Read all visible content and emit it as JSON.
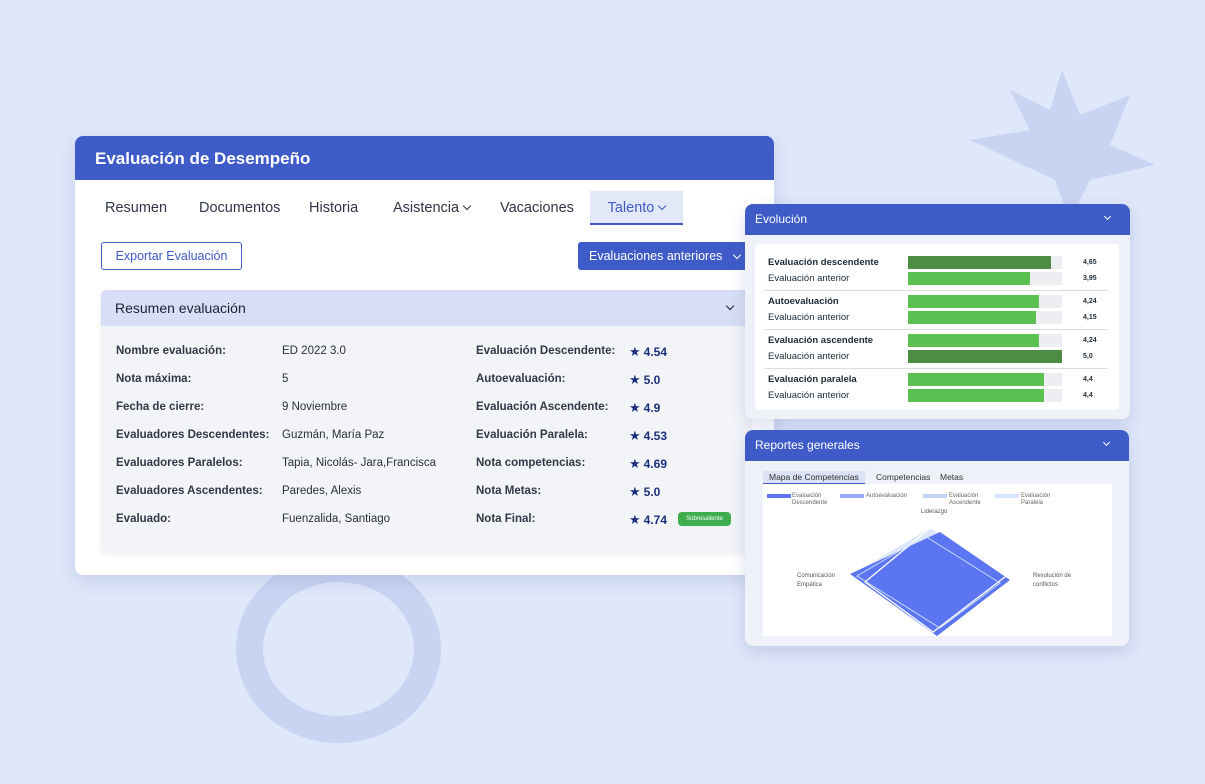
{
  "main": {
    "title": "Evaluación de Desempeño",
    "tabs": [
      {
        "label": "Resumen"
      },
      {
        "label": "Documentos"
      },
      {
        "label": "Historia"
      },
      {
        "label": "Asistencia"
      },
      {
        "label": "Vacaciones"
      },
      {
        "label": "Talento",
        "active": true
      }
    ],
    "export_label": "Exportar Evaluación",
    "previous_label": "Evaluaciones anteriores",
    "panel_title": "Resumen evaluación",
    "left_rows": [
      {
        "label": "Nombre evaluación:",
        "value": "ED 2022 3.0"
      },
      {
        "label": "Nota máxima:",
        "value": "5"
      },
      {
        "label": "Fecha de cierre:",
        "value": "9 Noviembre"
      },
      {
        "label": "Evaluadores Descendentes:",
        "value": "Guzmán, María Paz"
      },
      {
        "label": "Evaluadores Paralelos:",
        "value": "Tapia, Nicolás- Jara,Francisca"
      },
      {
        "label": "Evaluadores Ascendentes:",
        "value": "Paredes, Alexis"
      },
      {
        "label": "Evaluado:",
        "value": "Fuenzalida, Santiago"
      }
    ],
    "right_rows": [
      {
        "label": "Evaluación Descendente:",
        "score": "4.54"
      },
      {
        "label": "Autoevaluación:",
        "score": "5.0"
      },
      {
        "label": "Evaluación Ascendente:",
        "score": "4.9"
      },
      {
        "label": "Evaluación Paralela:",
        "score": "4.53"
      },
      {
        "label": "Nota competencias:",
        "score": "4.69"
      },
      {
        "label": "Nota Metas:",
        "score": "5.0"
      },
      {
        "label": "Nota Final:",
        "score": "4.74"
      }
    ],
    "final_badge": "Sobresaliente"
  },
  "evolucion": {
    "title": "Evolución",
    "rows": [
      {
        "label": "Evaluación descendente",
        "value_text": "4,65",
        "value": 4.65,
        "bold": true,
        "color": "#4e8c45"
      },
      {
        "label": "Evaluación anterior",
        "value_text": "3,95",
        "value": 3.95,
        "bold": false,
        "color": "#5cbf52"
      },
      {
        "label": "Autoevaluación",
        "value_text": "4,24",
        "value": 4.24,
        "bold": true,
        "color": "#5cbf52"
      },
      {
        "label": "Evaluación anterior",
        "value_text": "4,15",
        "value": 4.15,
        "bold": false,
        "color": "#5cbf52"
      },
      {
        "label": "Evaluación ascendente",
        "value_text": "4,24",
        "value": 4.24,
        "bold": true,
        "color": "#5cbf52"
      },
      {
        "label": "Evaluación anterior",
        "value_text": "5,0",
        "value": 5.0,
        "bold": false,
        "color": "#4e8c45"
      },
      {
        "label": "Evaluación paralela",
        "value_text": "4,4",
        "value": 4.4,
        "bold": true,
        "color": "#5cbf52"
      },
      {
        "label": "Evaluación anterior",
        "value_text": "4,4",
        "value": 4.4,
        "bold": false,
        "color": "#5cbf52"
      }
    ]
  },
  "reportes": {
    "title": "Reportes generales",
    "tabs": [
      {
        "label": "Mapa de Competencias",
        "active": true
      },
      {
        "label": "Competencias"
      },
      {
        "label": "Metas"
      }
    ],
    "legend": [
      {
        "label": "Evaluación Descendente",
        "color": "#5b76f0"
      },
      {
        "label": "Autoevaluación",
        "color": "#99a9f5"
      },
      {
        "label": "Evaluación Ascendente",
        "color": "#c3d4fa"
      },
      {
        "label": "Evaluación Paralela",
        "color": "#d6e6fb"
      }
    ],
    "axes": {
      "top": "Liderazgo",
      "left": "Comunicación Empática",
      "right": "Resolución de conflictos"
    }
  }
}
